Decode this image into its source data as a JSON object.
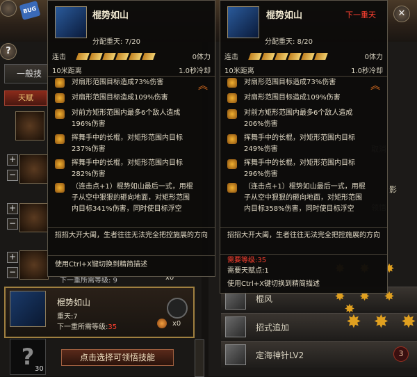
{
  "top": {
    "bug_label": "BUG",
    "help_label": "?"
  },
  "left_panel": {
    "tab_general": "一般技",
    "tab_talent": "天赋",
    "skill_rows": [
      {
        "level_line": "下一重所需等级: 9",
        "count": "x0"
      }
    ],
    "selected": {
      "name": "棍势如山",
      "level": "重天:7",
      "next_level_label": "下一重所需等级:",
      "next_level_value": "35",
      "count": "x0"
    },
    "unknown_count": "30",
    "learn_button": "点击选择可领悟技能"
  },
  "right_panel": {
    "rows": [
      {
        "name": "棍风"
      },
      {
        "name": "招式追加"
      },
      {
        "name": "定海神针LV2",
        "badge": "3"
      }
    ],
    "partial_labels": [
      "取消",
      "影",
      "领悟"
    ]
  },
  "tooltip_left": {
    "title": "棍势如山",
    "allocated": "分配重天: 7/20",
    "combo_label": "连击",
    "cost": "0体力",
    "range": "10米距离",
    "cooldown": "1.0秒冷却",
    "effects": [
      "对扇形范围目标造成73%伤害",
      "对扇形范围目标造成109%伤害",
      "对前方矩形范围内最多6个敌人造成196%伤害",
      "挥舞手中的长棍，对矩形范围内目标237%伤害",
      "挥舞手中的长棍，对矩形范围内目标282%伤害",
      "（连击点+1）棍势如山最后一式，用棍子从空中狠狠的砸向地面，对矩形范围内目标341%伤害，同时使目标浮空"
    ],
    "description": "招招大开大阖，生者往往无法完全把控施展的方向",
    "hint": "使用Ctrl+X键切换到精简描述"
  },
  "tooltip_right": {
    "title": "棍势如山",
    "next_label": "下一重天",
    "allocated": "分配重天: 8/20",
    "combo_label": "连击",
    "cost": "0体力",
    "range": "10米距离",
    "cooldown": "1.0秒冷却",
    "effects": [
      "对扇形范围目标造成73%伤害",
      "对扇形范围目标造成109%伤害",
      "对前方矩形范围内最多6个敌人造成206%伤害",
      "挥舞手中的长棍，对矩形范围内目标249%伤害",
      "挥舞手中的长棍，对矩形范围内目标296%伤害",
      "（连击点+1）棍势如山最后一式，用棍子从空中狠狠的砸向地面，对矩形范围内目标358%伤害，同时使目标浮空"
    ],
    "description": "招招大开大阖，生者往往无法完全把控施展的方向",
    "req_level": "需要等级:35",
    "req_points": "需要天赋点:1",
    "hint": "使用Ctrl+X键切换到精简描述"
  },
  "colors": {
    "accent_red": "#ff4030",
    "gold": "#e0a020",
    "tooltip_bg": "#0c0b0a"
  }
}
